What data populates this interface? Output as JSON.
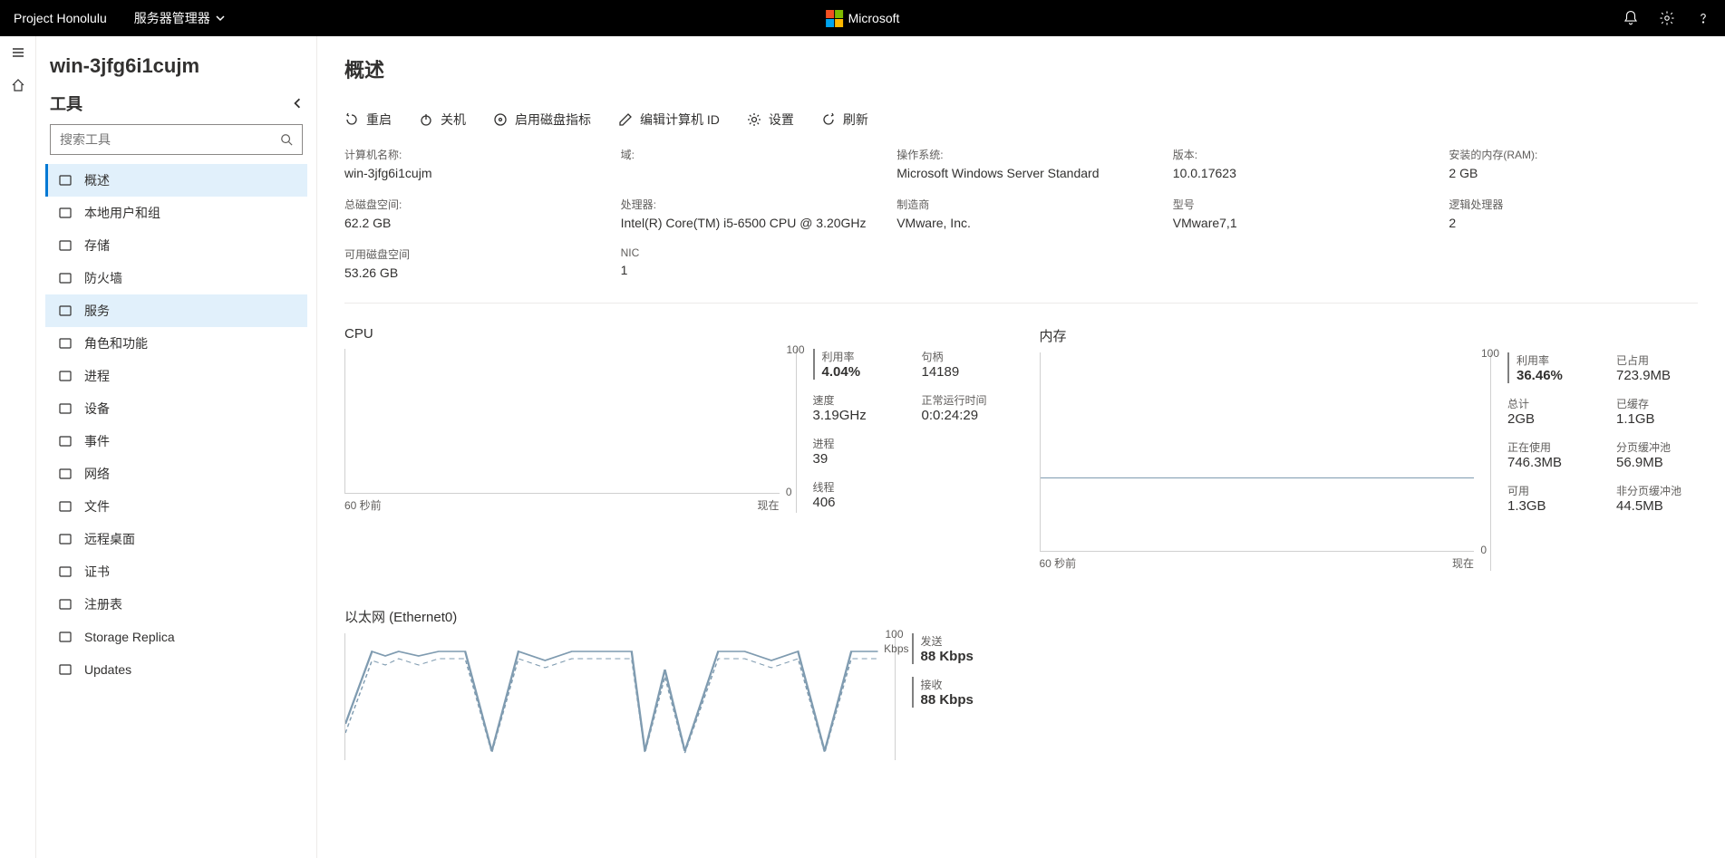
{
  "topbar": {
    "brand": "Project Honolulu",
    "solution": "服务器管理器",
    "ms": "Microsoft"
  },
  "hostname": "win-3jfg6i1cujm",
  "tools": {
    "header": "工具",
    "search_placeholder": "搜索工具",
    "items": [
      {
        "label": "概述",
        "active": true
      },
      {
        "label": "本地用户和组"
      },
      {
        "label": "存储"
      },
      {
        "label": "防火墙"
      },
      {
        "label": "服务",
        "hover": true
      },
      {
        "label": "角色和功能"
      },
      {
        "label": "进程"
      },
      {
        "label": "设备"
      },
      {
        "label": "事件"
      },
      {
        "label": "网络"
      },
      {
        "label": "文件"
      },
      {
        "label": "远程桌面"
      },
      {
        "label": "证书"
      },
      {
        "label": "注册表"
      },
      {
        "label": "Storage Replica"
      },
      {
        "label": "Updates"
      }
    ]
  },
  "page": {
    "title": "概述"
  },
  "actions": {
    "restart": "重启",
    "shutdown": "关机",
    "disk": "启用磁盘指标",
    "edit": "编辑计算机 ID",
    "settings": "设置",
    "refresh": "刷新"
  },
  "info": {
    "computer_name": {
      "label": "计算机名称:",
      "value": "win-3jfg6i1cujm"
    },
    "domain": {
      "label": "域:",
      "value": ""
    },
    "os": {
      "label": "操作系统:",
      "value": "Microsoft Windows Server Standard"
    },
    "version": {
      "label": "版本:",
      "value": "10.0.17623"
    },
    "ram": {
      "label": "安装的内存(RAM):",
      "value": "2 GB"
    },
    "disk_total": {
      "label": "总磁盘空间:",
      "value": "62.2 GB"
    },
    "processor": {
      "label": "处理器:",
      "value": "Intel(R) Core(TM) i5-6500 CPU @ 3.20GHz"
    },
    "mfr": {
      "label": "制造商",
      "value": "VMware, Inc."
    },
    "model": {
      "label": "型号",
      "value": "VMware7,1"
    },
    "lcpu": {
      "label": "逻辑处理器",
      "value": "2"
    },
    "disk_free": {
      "label": "可用磁盘空间",
      "value": "53.26 GB"
    },
    "nic": {
      "label": "NIC",
      "value": "1"
    }
  },
  "cpu": {
    "title": "CPU",
    "ymax": "100",
    "ymin": "0",
    "xl": "60 秒前",
    "xr": "现在",
    "util": {
      "label": "利用率",
      "value": "4.04%"
    },
    "handles": {
      "label": "句柄",
      "value": "14189"
    },
    "speed": {
      "label": "速度",
      "value": "3.19GHz"
    },
    "uptime": {
      "label": "正常运行时间",
      "value": "0:0:24:29"
    },
    "procs": {
      "label": "进程",
      "value": "39"
    },
    "threads": {
      "label": "线程",
      "value": "406"
    }
  },
  "mem": {
    "title": "内存",
    "ymax": "100",
    "ymin": "0",
    "xl": "60 秒前",
    "xr": "现在",
    "util": {
      "label": "利用率",
      "value": "36.46%"
    },
    "inuse": {
      "label": "已占用",
      "value": "723.9MB"
    },
    "total": {
      "label": "总计",
      "value": "2GB"
    },
    "cached": {
      "label": "已缓存",
      "value": "1.1GB"
    },
    "committed": {
      "label": "正在使用",
      "value": "746.3MB"
    },
    "paged": {
      "label": "分页缓冲池",
      "value": "56.9MB"
    },
    "avail": {
      "label": "可用",
      "value": "1.3GB"
    },
    "nonpaged": {
      "label": "非分页缓冲池",
      "value": "44.5MB"
    }
  },
  "net": {
    "title": "以太网 (Ethernet0)",
    "ymax": "100",
    "yunit": "Kbps",
    "send": {
      "label": "发送",
      "value": "88 Kbps"
    },
    "recv": {
      "label": "接收",
      "value": "88 Kbps"
    }
  },
  "chart_data": {
    "cpu": {
      "type": "line",
      "title": "CPU",
      "ylabel": "利用率 %",
      "ylim": [
        0,
        100
      ],
      "x_range": [
        "60 秒前",
        "现在"
      ],
      "series": [
        {
          "name": "利用率",
          "values": [
            4,
            4,
            4,
            4,
            4,
            4,
            4,
            4,
            4,
            4,
            4,
            4,
            4,
            4,
            4,
            4,
            4,
            4,
            4,
            4
          ]
        }
      ]
    },
    "memory": {
      "type": "line",
      "title": "内存",
      "ylabel": "利用率 %",
      "ylim": [
        0,
        100
      ],
      "x_range": [
        "60 秒前",
        "现在"
      ],
      "series": [
        {
          "name": "利用率",
          "values": [
            36,
            36,
            36,
            36,
            36,
            36,
            36,
            36,
            36,
            36,
            36,
            36,
            36,
            36,
            36,
            36,
            36,
            36,
            36,
            36
          ]
        }
      ]
    },
    "ethernet": {
      "type": "line",
      "title": "以太网 (Ethernet0)",
      "ylabel": "Kbps",
      "ylim": [
        0,
        100
      ],
      "x_range": [
        "60 秒前",
        "现在"
      ],
      "series": [
        {
          "name": "发送",
          "values": [
            30,
            88,
            85,
            88,
            80,
            88,
            10,
            88,
            80,
            88,
            88,
            5,
            70,
            5,
            88,
            88,
            80,
            88,
            10,
            88
          ]
        },
        {
          "name": "接收",
          "values": [
            25,
            80,
            80,
            85,
            70,
            85,
            8,
            85,
            75,
            85,
            85,
            4,
            65,
            4,
            85,
            85,
            75,
            85,
            8,
            85
          ]
        }
      ]
    }
  }
}
